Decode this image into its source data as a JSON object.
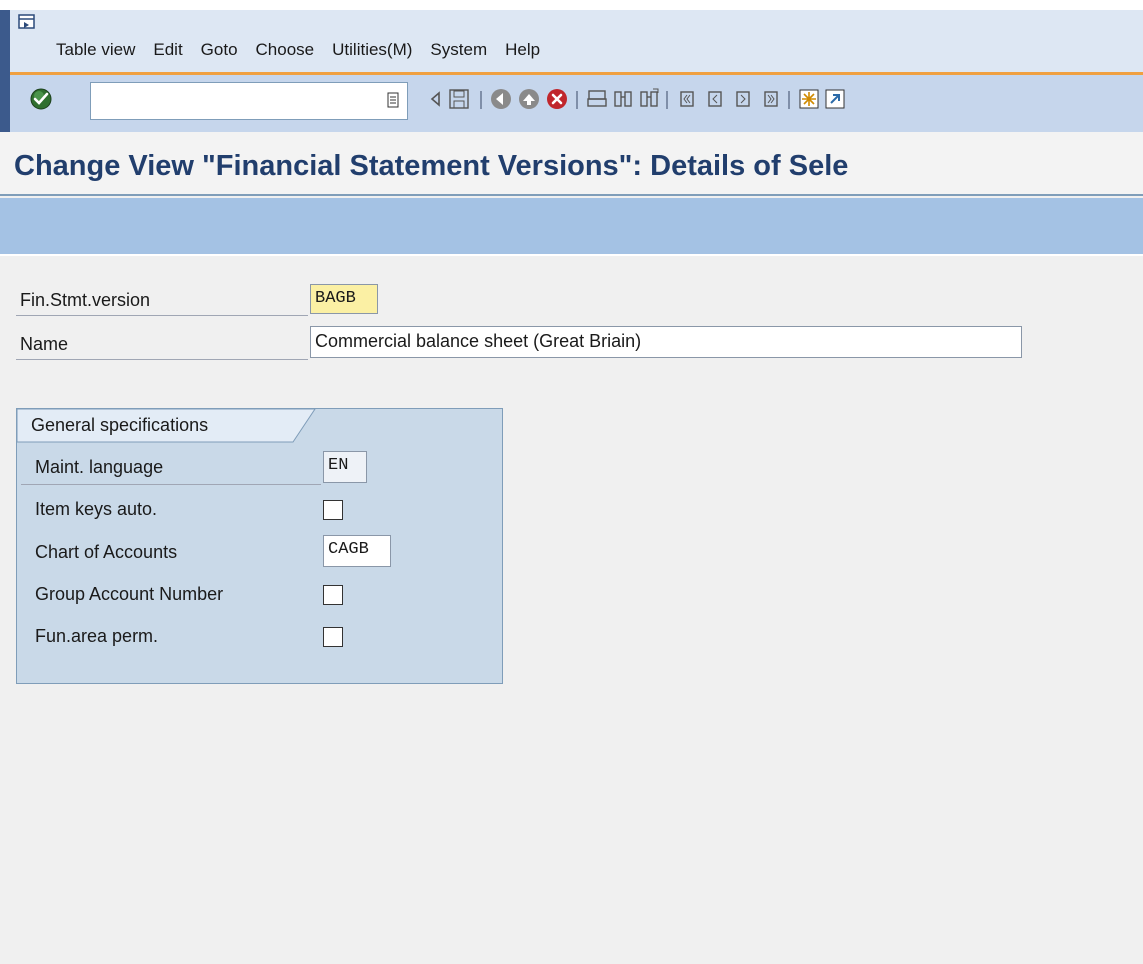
{
  "menu": {
    "items": [
      {
        "label": "Table view"
      },
      {
        "label": "Edit"
      },
      {
        "label": "Goto"
      },
      {
        "label": "Choose"
      },
      {
        "label": "Utilities(M)"
      },
      {
        "label": "System"
      },
      {
        "label": "Help"
      }
    ]
  },
  "toolbar": {
    "command_value": "",
    "icons": [
      "enter-icon",
      "back-arrow-icon",
      "save-icon",
      "back-icon",
      "exit-icon",
      "cancel-icon",
      "print-icon",
      "find-icon",
      "find-next-icon",
      "first-page-icon",
      "previous-page-icon",
      "next-page-icon",
      "last-page-icon",
      "create-session-icon",
      "shortcut-icon"
    ]
  },
  "page": {
    "title": "Change View \"Financial Statement Versions\": Details of Sele"
  },
  "fields": {
    "fin_stmt_version": {
      "label": "Fin.Stmt.version",
      "value": "BAGB"
    },
    "name": {
      "label": "Name",
      "value": "Commercial balance sheet (Great Briain)"
    }
  },
  "group": {
    "title": "General specifications",
    "maint_language": {
      "label": "Maint. language",
      "value": "EN"
    },
    "item_keys_auto": {
      "label": "Item keys auto.",
      "checked": false
    },
    "chart_of_accounts": {
      "label": "Chart of Accounts",
      "value": "CAGB"
    },
    "group_account_number": {
      "label": "Group Account Number",
      "checked": false
    },
    "fun_area_perm": {
      "label": "Fun.area perm.",
      "checked": false
    }
  },
  "colors": {
    "title": "#213e6d",
    "toolbar": "#c6d6ec",
    "app_toolbar": "#a4c2e4",
    "group_box": "#c9d9e8",
    "key_field": "#fbf0a4",
    "accent_line": "#f0a040"
  }
}
